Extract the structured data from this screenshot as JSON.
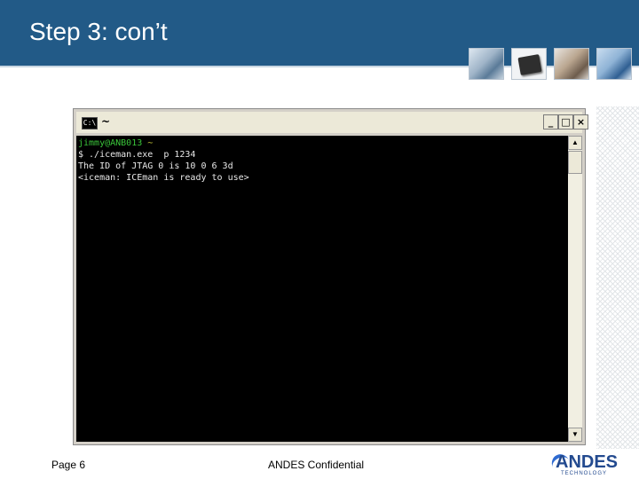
{
  "slide": {
    "title": "Step 3: con’t"
  },
  "thumbnails": [
    {
      "icon": "pda-stylus-photo"
    },
    {
      "icon": "chip-photo"
    },
    {
      "icon": "phone-call-photo"
    },
    {
      "icon": "road-photo"
    }
  ],
  "console": {
    "title": "~",
    "buttons": {
      "minimize": "_",
      "maximize": "□",
      "close": "×"
    },
    "lines": {
      "user": "jimmy@ANB013",
      "path": " ~",
      "command": "$ ./iceman.exe  p 1234",
      "output1": "The ID of JTAG 0 is 10 0 6 3d",
      "output2": "<iceman: ICEman is ready to use>"
    },
    "colors": {
      "background": "#000000",
      "prompt_user": "#3ac53a",
      "prompt_path": "#c9c93a",
      "text": "#e8e8e8"
    }
  },
  "footer": {
    "page": "Page 6",
    "confidential": "ANDES Confidential",
    "logo_main": "ANDES",
    "logo_sub": "TECHNOLOGY"
  },
  "colors": {
    "header": "#225a87",
    "logo": "#234a8f"
  }
}
